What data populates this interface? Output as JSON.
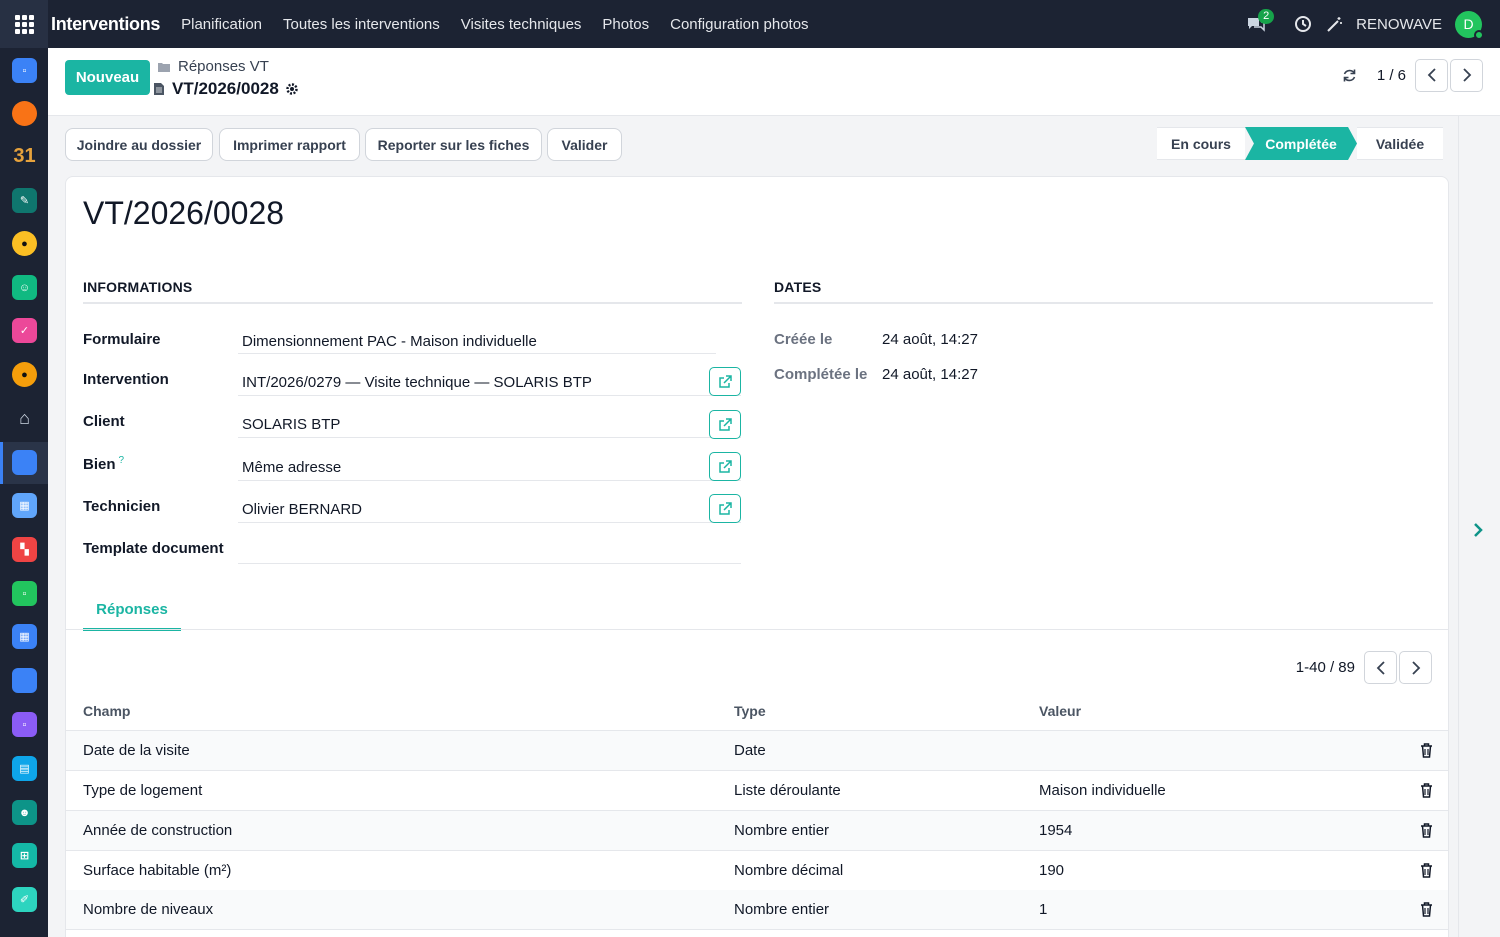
{
  "navbar": {
    "app_name": "Interventions",
    "menu": [
      "Planification",
      "Toutes les interventions",
      "Visites techniques",
      "Photos",
      "Configuration photos"
    ],
    "chat_badge": "2",
    "company": "RENOWAVE",
    "avatar_initial": "D"
  },
  "dock": {
    "colors": [
      "#3b82f6",
      "#f97316",
      "#e6a23c",
      "#14b8a6",
      "#fbbf24",
      "#10b981",
      "#ec4899",
      "#f59e0b",
      "#94a3b8",
      "#3b82f6",
      "#60a5fa",
      "#ef4444",
      "#22c55e",
      "#3b82f6",
      "#3b82f6",
      "#8b5cf6",
      "#0ea5e9",
      "#0d9488",
      "#14b8a6",
      "#2dd4bf"
    ],
    "calendar_label": "31"
  },
  "control": {
    "new_button": "Nouveau",
    "breadcrumb_parent": "Réponses VT",
    "record_name": "VT/2026/0028",
    "pager": "1 / 6"
  },
  "actions": {
    "buttons": [
      "Joindre au dossier",
      "Imprimer rapport",
      "Reporter sur les fiches",
      "Valider"
    ],
    "stages": [
      "En cours",
      "Complétée",
      "Validée"
    ],
    "active_stage": "Complétée"
  },
  "form": {
    "title": "VT/2026/0028",
    "informations_title": "INFORMATIONS",
    "dates_title": "DATES",
    "fields": [
      {
        "label": "Formulaire",
        "value": "Dimensionnement PAC - Maison individuelle"
      },
      {
        "label": "Intervention",
        "value": "INT/2026/0279 — Visite technique — SOLARIS BTP"
      },
      {
        "label": "Client",
        "value": "SOLARIS BTP"
      },
      {
        "label": "Bien",
        "value": "Même adresse",
        "help": "?"
      },
      {
        "label": "Technicien",
        "value": "Olivier BERNARD"
      },
      {
        "label": "Template document",
        "value": ""
      }
    ],
    "dates": [
      {
        "label": "Créée le",
        "value": "24 août, 14:27"
      },
      {
        "label": "Complétée le",
        "value": "24 août, 14:27"
      }
    ]
  },
  "tabs": {
    "active": "Réponses"
  },
  "responses": {
    "pager": "1-40 / 89",
    "columns": [
      "Champ",
      "Type",
      "Valeur"
    ],
    "rows": [
      {
        "champ": "Date de la visite",
        "type": "Date",
        "valeur": ""
      },
      {
        "champ": "Type de logement",
        "type": "Liste déroulante",
        "valeur": "Maison individuelle"
      },
      {
        "champ": "Année de construction",
        "type": "Nombre entier",
        "valeur": "1954"
      },
      {
        "champ": "Surface habitable (m²)",
        "type": "Nombre décimal",
        "valeur": "190"
      },
      {
        "champ": "Nombre de niveaux",
        "type": "Nombre entier",
        "valeur": "1"
      }
    ]
  },
  "theme": {
    "accent": "#1bb5a3",
    "navbar_bg": "#1c2333"
  }
}
